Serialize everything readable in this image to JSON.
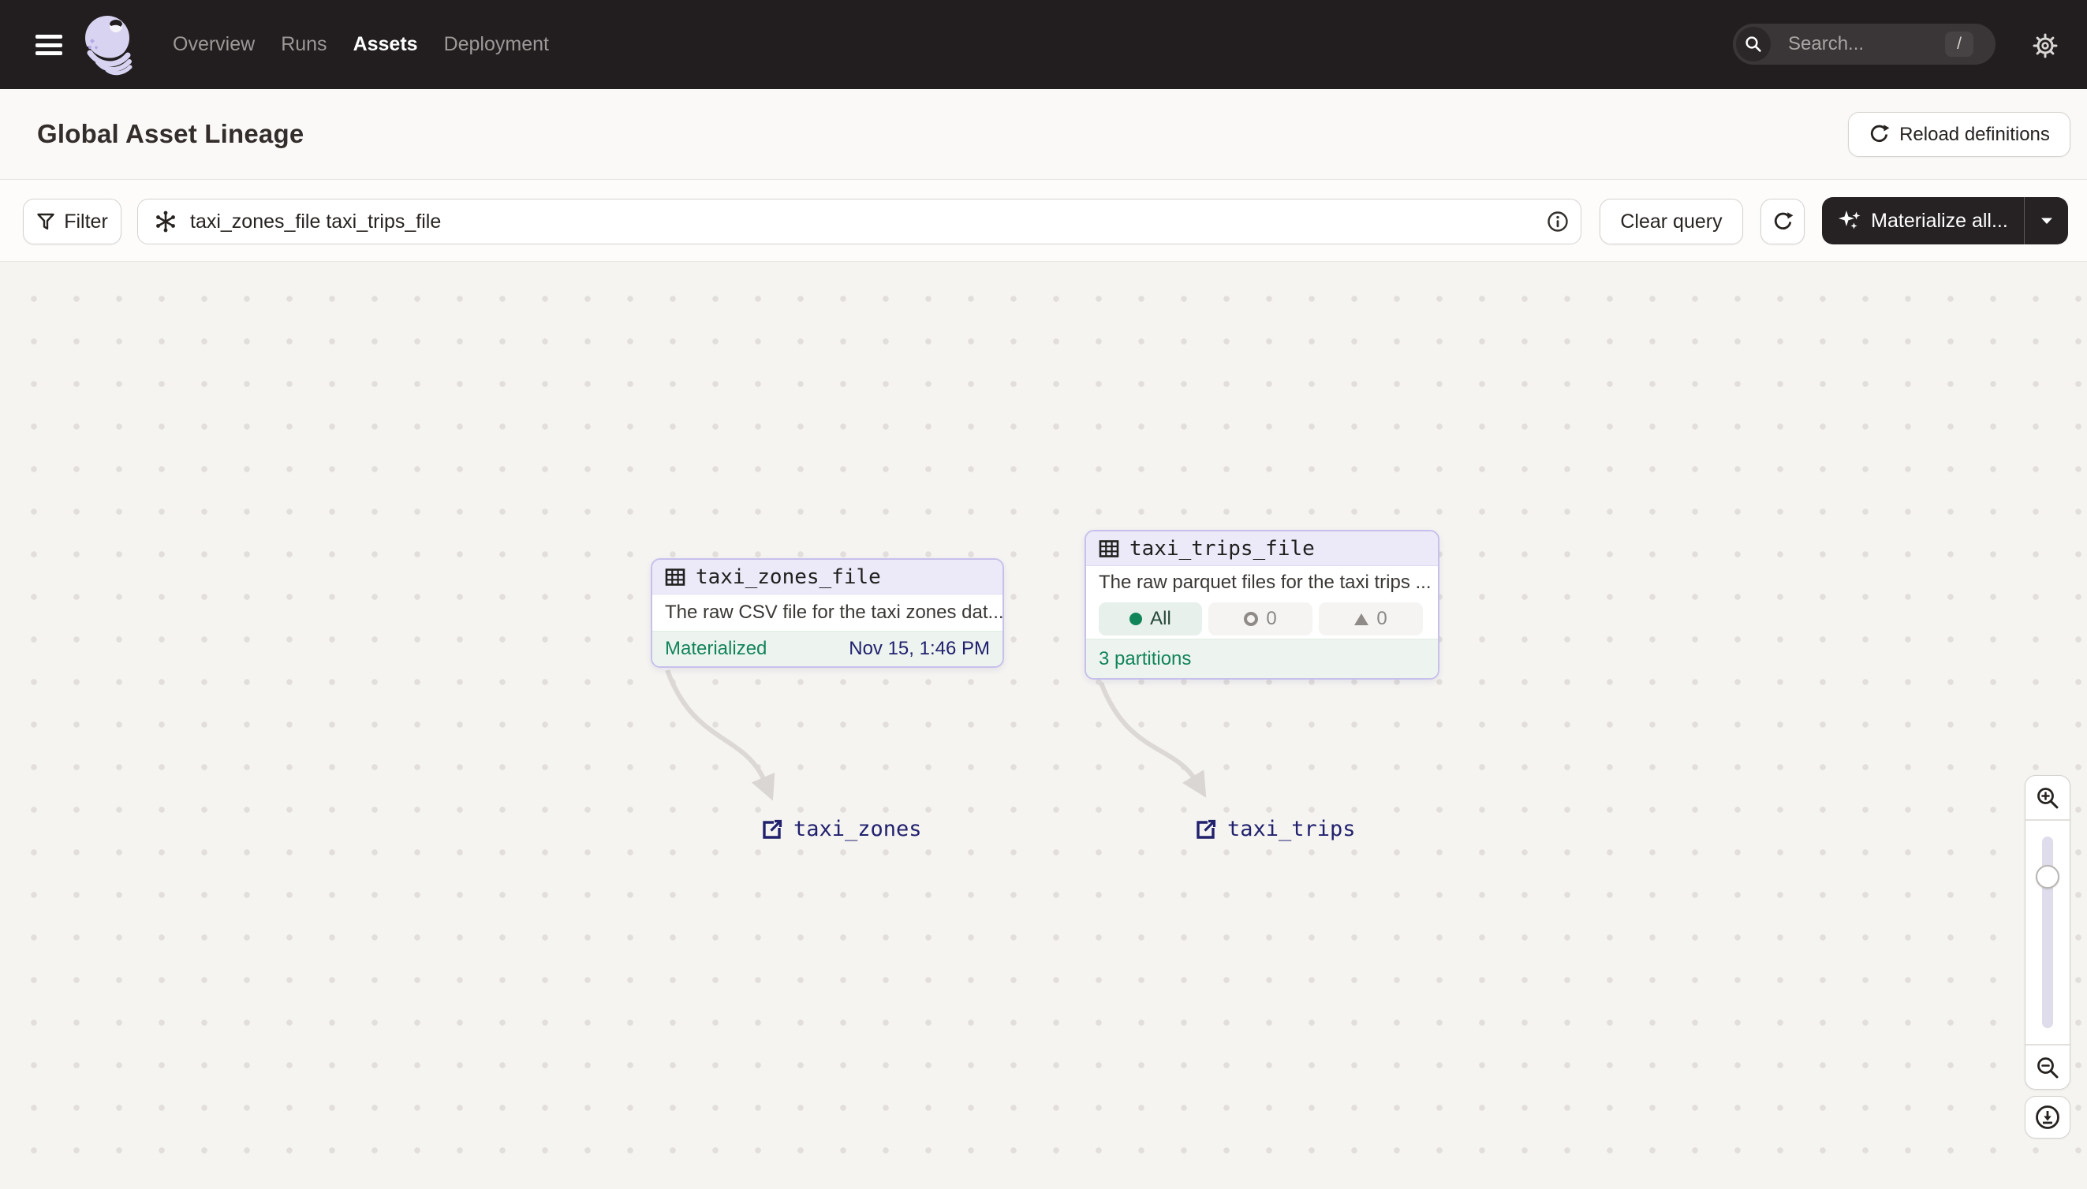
{
  "topbar": {
    "nav": [
      {
        "label": "Overview",
        "active": false
      },
      {
        "label": "Runs",
        "active": false
      },
      {
        "label": "Assets",
        "active": true
      },
      {
        "label": "Deployment",
        "active": false
      }
    ],
    "search": {
      "placeholder": "Search...",
      "shortcut": "/"
    }
  },
  "header": {
    "title": "Global Asset Lineage",
    "reload_label": "Reload definitions"
  },
  "toolbar": {
    "filter_label": "Filter",
    "query": "taxi_zones_file taxi_trips_file",
    "clear_label": "Clear query",
    "materialize_label": "Materialize all..."
  },
  "graph": {
    "nodes": [
      {
        "name": "taxi_zones_file",
        "description": "The raw CSV file for the taxi zones dat...",
        "status": "Materialized",
        "timestamp": "Nov 15, 1:46 PM"
      },
      {
        "name": "taxi_trips_file",
        "description": "The raw parquet files for the taxi trips ...",
        "badges": {
          "all": "All",
          "failed": "0",
          "missing": "0"
        },
        "partitions": "3 partitions"
      }
    ],
    "external_assets": [
      {
        "name": "taxi_zones"
      },
      {
        "name": "taxi_trips"
      }
    ]
  },
  "icons": {
    "menu-icon": "hamburger-bars",
    "search-icon": "magnifier",
    "gear-icon": "gear",
    "refresh-icon": "circular-arrow",
    "funnel-icon": "filter-funnel",
    "op-selector-icon": "asterisk-with-dots",
    "info-icon": "circled-i",
    "sparkle-icon": "four-point-stars",
    "caret-down-icon": "down-triangle",
    "table-icon": "grid-table",
    "external-link-icon": "box-with-arrow",
    "zoom-in-icon": "magnifier-plus",
    "zoom-out-icon": "magnifier-minus",
    "download-icon": "circled-down-arrow"
  },
  "colors": {
    "topbar_bg": "#221E1F",
    "node_border": "#C6C0EB",
    "node_header_bg": "#ECEAF9",
    "node_footer_bg": "#EDF4EF",
    "green": "#12845A",
    "navy": "#21216E",
    "canvas_bg": "#F5F4F1"
  }
}
